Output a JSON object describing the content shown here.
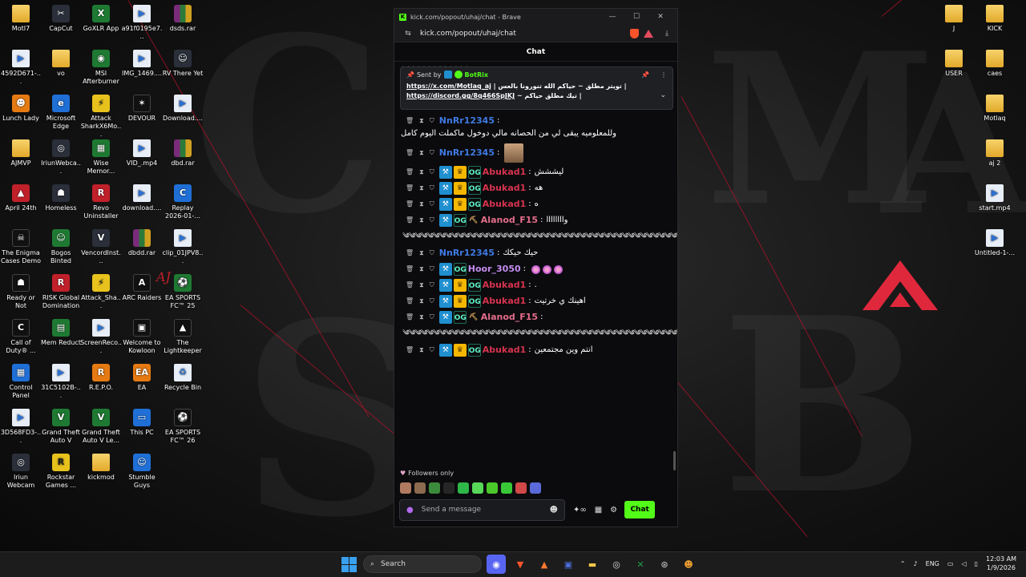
{
  "desktop": {
    "icons": [
      {
        "label": "MotI7",
        "type": "folder",
        "glyph": ""
      },
      {
        "label": "CapCut",
        "type": "app",
        "glyph": "✂"
      },
      {
        "label": "GoXLR App",
        "type": "green",
        "glyph": "X"
      },
      {
        "label": "a91f0195e7...",
        "type": "file",
        "glyph": "▶"
      },
      {
        "label": "dsds.rar",
        "type": "rar",
        "glyph": ""
      },
      {
        "label": "4592D671-...",
        "type": "file",
        "glyph": "▶"
      },
      {
        "label": "vo",
        "type": "folder",
        "glyph": ""
      },
      {
        "label": "MSI Afterburner",
        "type": "green",
        "glyph": "◉"
      },
      {
        "label": "IMG_1469....",
        "type": "file",
        "glyph": "▶"
      },
      {
        "label": "RV There Yet",
        "type": "app",
        "glyph": "☺"
      },
      {
        "label": "Lunch Lady",
        "type": "orange",
        "glyph": "☻"
      },
      {
        "label": "Microsoft Edge",
        "type": "blue",
        "glyph": "e"
      },
      {
        "label": "Attack SharkX6Mo...",
        "type": "yellow",
        "glyph": "⚡"
      },
      {
        "label": "DEVOUR",
        "type": "dark",
        "glyph": "✶"
      },
      {
        "label": "Download....",
        "type": "file",
        "glyph": "▶"
      },
      {
        "label": "AJMVP",
        "type": "folder",
        "glyph": ""
      },
      {
        "label": "IriunWebca...",
        "type": "app",
        "glyph": "◎"
      },
      {
        "label": "Wise Memor...",
        "type": "green",
        "glyph": "▦"
      },
      {
        "label": "VID_.mp4",
        "type": "file",
        "glyph": "▶"
      },
      {
        "label": "dbd.rar",
        "type": "rar",
        "glyph": ""
      },
      {
        "label": "April 24th",
        "type": "red",
        "glyph": "▲"
      },
      {
        "label": "Homeless",
        "type": "app",
        "glyph": "☗"
      },
      {
        "label": "Revo Uninstaller",
        "type": "red",
        "glyph": "R"
      },
      {
        "label": "download....",
        "type": "file",
        "glyph": "▶"
      },
      {
        "label": "Replay 2026-01-...",
        "type": "blue",
        "glyph": "C"
      },
      {
        "label": "The Enigma Cases Demo",
        "type": "dark",
        "glyph": "☠"
      },
      {
        "label": "Bogos Binted",
        "type": "green",
        "glyph": "☺"
      },
      {
        "label": "VencordInst...",
        "type": "app",
        "glyph": "V"
      },
      {
        "label": "dbdd.rar",
        "type": "rar",
        "glyph": ""
      },
      {
        "label": "clip_01JPV8...",
        "type": "file",
        "glyph": "▶"
      },
      {
        "label": "Ready or Not",
        "type": "dark",
        "glyph": "☗"
      },
      {
        "label": "RISK Global Domination",
        "type": "red",
        "glyph": "R"
      },
      {
        "label": "Attack_Sha...",
        "type": "yellow",
        "glyph": "⚡"
      },
      {
        "label": "ARC Raiders",
        "type": "dark",
        "glyph": "A"
      },
      {
        "label": "EA SPORTS FC™ 25",
        "type": "green",
        "glyph": "⚽"
      },
      {
        "label": "Call of Duty® ...",
        "type": "dark",
        "glyph": "C"
      },
      {
        "label": "Mem Reduct",
        "type": "green",
        "glyph": "▤"
      },
      {
        "label": "ScreenReco...",
        "type": "file",
        "glyph": "▶"
      },
      {
        "label": "Welcome to Kowloon",
        "type": "dark",
        "glyph": "▣"
      },
      {
        "label": "The Lightkeeper",
        "type": "dark",
        "glyph": "▲"
      },
      {
        "label": "Control Panel",
        "type": "blue",
        "glyph": "▦"
      },
      {
        "label": "31C5102B-...",
        "type": "file",
        "glyph": "▶"
      },
      {
        "label": "R.E.P.O.",
        "type": "orange",
        "glyph": "R"
      },
      {
        "label": "EA",
        "type": "orange",
        "glyph": "EA"
      },
      {
        "label": "Recycle Bin",
        "type": "file",
        "glyph": "♻"
      },
      {
        "label": "3D568FD3-...",
        "type": "file",
        "glyph": "▶"
      },
      {
        "label": "Grand Theft Auto V",
        "type": "green",
        "glyph": "V"
      },
      {
        "label": "Grand Theft Auto V Le...",
        "type": "green",
        "glyph": "V"
      },
      {
        "label": "This PC",
        "type": "blue",
        "glyph": "▭"
      },
      {
        "label": "EA SPORTS FC™ 26",
        "type": "dark",
        "glyph": "⚽"
      },
      {
        "label": "Iriun Webcam",
        "type": "app",
        "glyph": "◎"
      },
      {
        "label": "Rockstar Games ...",
        "type": "yellow",
        "glyph": "R"
      },
      {
        "label": "kickmod",
        "type": "folder",
        "glyph": ""
      },
      {
        "label": "Stumble Guys",
        "type": "blue",
        "glyph": "☺"
      }
    ],
    "right_icons": [
      {
        "label": "J",
        "type": "folder"
      },
      {
        "label": "KICK",
        "type": "folder"
      },
      {
        "label": "USER",
        "type": "folder"
      },
      {
        "label": "caes",
        "type": "folder"
      },
      {
        "label": "Motlaq",
        "type": "folder"
      },
      {
        "label": "aj 2",
        "type": "folder"
      },
      {
        "label": "start.mp4",
        "type": "file"
      },
      {
        "label": "Untitled-1-...",
        "type": "file"
      }
    ],
    "wallpaper_letters": [
      "C",
      "O",
      "S",
      "M",
      "B",
      "A"
    ],
    "aj_sign": "AJ"
  },
  "browser": {
    "title": "kick.com/popout/uhaj/chat - Brave",
    "url": "kick.com/popout/uhaj/chat",
    "controls": {
      "minimize": "—",
      "maximize": "☐",
      "close": "✕"
    }
  },
  "chat": {
    "header": "Chat",
    "top_residue": "༄༄༄༄༄༄༄༄༄༄༄༄༄",
    "pinned": {
      "sent_by_label": "Sent by",
      "bot_name": "BotRix",
      "line1_link": "https://x.com/Motlaq_aj",
      "line1_text": " | تويتر مطلق ~ حياكم الله تنورونا بالعس |",
      "line2_link": "https://discord.gg/8q466SpJKJ",
      "line2_text": " ~ تيك مطلق حياكم | "
    },
    "messages": [
      {
        "user": "NnRr12345",
        "color": "#3f7ae3",
        "badges": [],
        "text": "وللمعلوميه يبقى لي من الحصانه مالي دوخول ماكملت اليوم كامل"
      },
      {
        "user": "NnRr12345",
        "color": "#3f7ae3",
        "badges": [],
        "text": "",
        "image": true
      },
      {
        "user": "Abukad1",
        "color": "#d6334e",
        "badges": [
          "mod",
          "crown",
          "og"
        ],
        "text": "ليششش"
      },
      {
        "user": "Abukad1",
        "color": "#d6334e",
        "badges": [
          "mod",
          "crown",
          "og"
        ],
        "text": "هه"
      },
      {
        "user": "Abukad1",
        "color": "#d6334e",
        "badges": [
          "mod",
          "crown",
          "og"
        ],
        "text": "ه"
      },
      {
        "user": "Alanod_F15",
        "color": "#e36d8a",
        "badges": [
          "mod",
          "og",
          "pick"
        ],
        "text": "واااااااا"
      },
      {
        "wide": "༄༄༄༄༄༄༄༄༄༄༄༄༄༄༄༄༄༄༄༄༄༄༄༄༄༄༄༄༄༄༄༄༄༄༄༄༄༄༄༄༄༄༄༄༄༄༄༄༄༄༄༄༄༄༄༄༄༄༄༄༄༄༄༄༄༄༄༄༄༄༄༄༄༄༄༄༄༄༄༄༄༄༄༄༄༄༄༄༄༄༄༄༄༄༄༄༄༄༄༄༄༄༄༄༄༄༄༄༄༄༄༄༄༄༄༄༄༄༄༄༄༄༄༄༄༄༄༄༄༄༄༄༄༄༄"
      },
      {
        "user": "NnRr12345",
        "color": "#3f7ae3",
        "badges": [],
        "text": "حيك حيكك"
      },
      {
        "user": "Hoor_3050",
        "color": "#c58cf0",
        "badges": [
          "mod",
          "og"
        ],
        "text": "",
        "emotes": 3
      },
      {
        "user": "Abukad1",
        "color": "#d6334e",
        "badges": [
          "mod",
          "crown",
          "og"
        ],
        "text": "."
      },
      {
        "user": "Abukad1",
        "color": "#d6334e",
        "badges": [
          "mod",
          "crown",
          "og"
        ],
        "text": "اهينك ي خرتيت"
      },
      {
        "user": "Alanod_F15",
        "color": "#e36d8a",
        "badges": [
          "mod",
          "og",
          "pick"
        ],
        "text": ""
      },
      {
        "wide": "༄༄༄༄༄༄༄༄༄༄༄༄༄༄༄༄༄༄༄༄༄༄༄༄༄༄༄༄༄༄༄༄༄༄༄༄༄༄༄༄༄༄༄༄༄༄༄༄༄༄༄༄༄༄༄༄༄༄༄༄༄༄༄༄༄༄༄༄༄༄༄༄༄༄༄༄༄༄༄༄༄༄༄༄༄༄༄༄༄༄༄༄༄༄༄༄༄༄༄༄༄༄༄༄༄༄༄༄༄༄༄༄༄༄༄༄༄༄༄༄༄༄༄༄༄༄༄༄༄༄༄༄༄༄༄༄"
      },
      {
        "user": "Abukad1",
        "color": "#d6334e",
        "badges": [
          "mod",
          "crown",
          "og"
        ],
        "text": "انتم وين مجتمعين"
      }
    ],
    "followers_only": "Followers only",
    "input_placeholder": "Send a message",
    "send_label": "Chat"
  },
  "taskbar": {
    "search_label": "Search",
    "apps": [
      "discord",
      "brave",
      "arc",
      "teams",
      "explorer",
      "webcam",
      "xbox",
      "steam",
      "discord2"
    ],
    "language": "ENG",
    "time": "12:03 AM",
    "date": "1/9/2026"
  }
}
